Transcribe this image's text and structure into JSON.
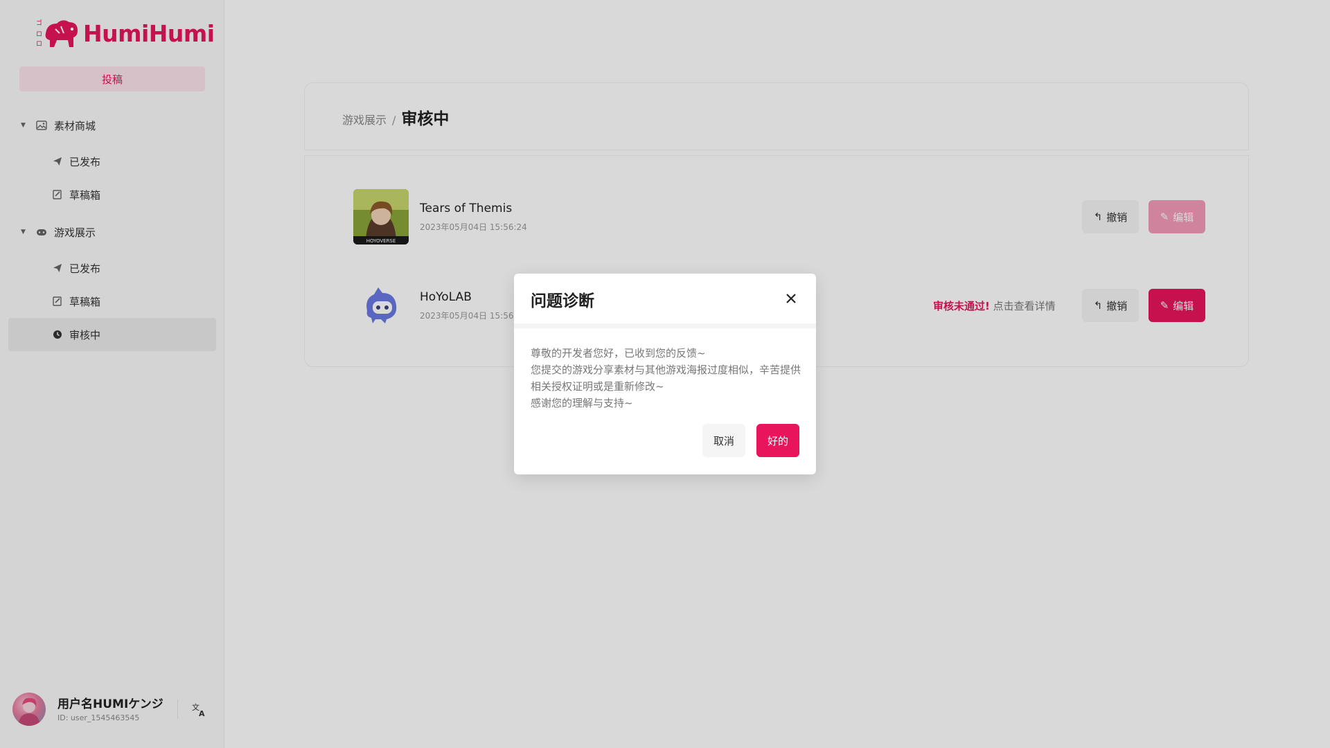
{
  "brand": {
    "name": "HumiHumi",
    "accent": "#e8145c"
  },
  "sidebar": {
    "post_button": "投稿",
    "groups": [
      {
        "label": "素材商城",
        "icon": "image-icon",
        "items": [
          {
            "label": "已发布",
            "icon": "send-icon"
          },
          {
            "label": "草稿箱",
            "icon": "draft-icon"
          }
        ]
      },
      {
        "label": "游戏展示",
        "icon": "gamepad-icon",
        "items": [
          {
            "label": "已发布",
            "icon": "send-icon"
          },
          {
            "label": "草稿箱",
            "icon": "draft-icon"
          },
          {
            "label": "审核中",
            "icon": "clock-icon",
            "active": true
          }
        ]
      }
    ],
    "user": {
      "name": "用户名HUMIケンジ",
      "id": "ID: user_1545463545"
    }
  },
  "breadcrumb": {
    "parent": "游戏展示",
    "separator": "/",
    "current": "审核中"
  },
  "list": [
    {
      "title": "Tears of Themis",
      "date": "2023年05月04日 15:56:24",
      "thumb_label": "HOYOVERSE",
      "revoke": "撤销",
      "edit": "编辑",
      "edit_disabled": true
    },
    {
      "title": "HoYoLAB",
      "date": "2023年05月04日 15:56:24",
      "reject_text": "审核未通过!",
      "detail_text": "点击查看详情",
      "revoke": "撤销",
      "edit": "编辑",
      "edit_disabled": false
    }
  ],
  "modal": {
    "title": "问题诊断",
    "lines": [
      "尊敬的开发者您好，已收到您的反馈~",
      "您提交的游戏分享素材与其他游戏海报过度相似，辛苦提供相关授权证明或是重新修改~",
      "感谢您的理解与支持~"
    ],
    "cancel": "取消",
    "ok": "好的"
  }
}
